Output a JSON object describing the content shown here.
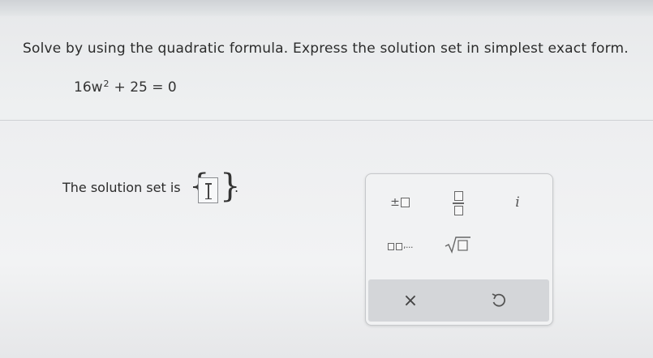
{
  "problem": {
    "instruction": "Solve by using the quadratic formula. Express the solution set in simplest exact form.",
    "equation_coeff": "16w",
    "equation_exp": "2",
    "equation_rest": "+ 25 = 0"
  },
  "answer": {
    "label": "The solution set is",
    "open_brace": "{",
    "close_brace": "}",
    "period": ".",
    "value": ""
  },
  "palette": {
    "plus_minus_symbol": "±",
    "imaginary_label": "i",
    "list_separator": ",...",
    "clear_label": "×",
    "buttons": [
      {
        "name": "plus-minus",
        "icon": "plus-minus-box-icon"
      },
      {
        "name": "fraction",
        "icon": "fraction-icon"
      },
      {
        "name": "imaginary-unit",
        "icon": "italic-i-icon"
      },
      {
        "name": "list",
        "icon": "list-boxes-icon"
      },
      {
        "name": "square-root",
        "icon": "sqrt-icon"
      },
      {
        "name": "clear",
        "icon": "close-icon"
      },
      {
        "name": "undo",
        "icon": "undo-icon"
      }
    ]
  }
}
